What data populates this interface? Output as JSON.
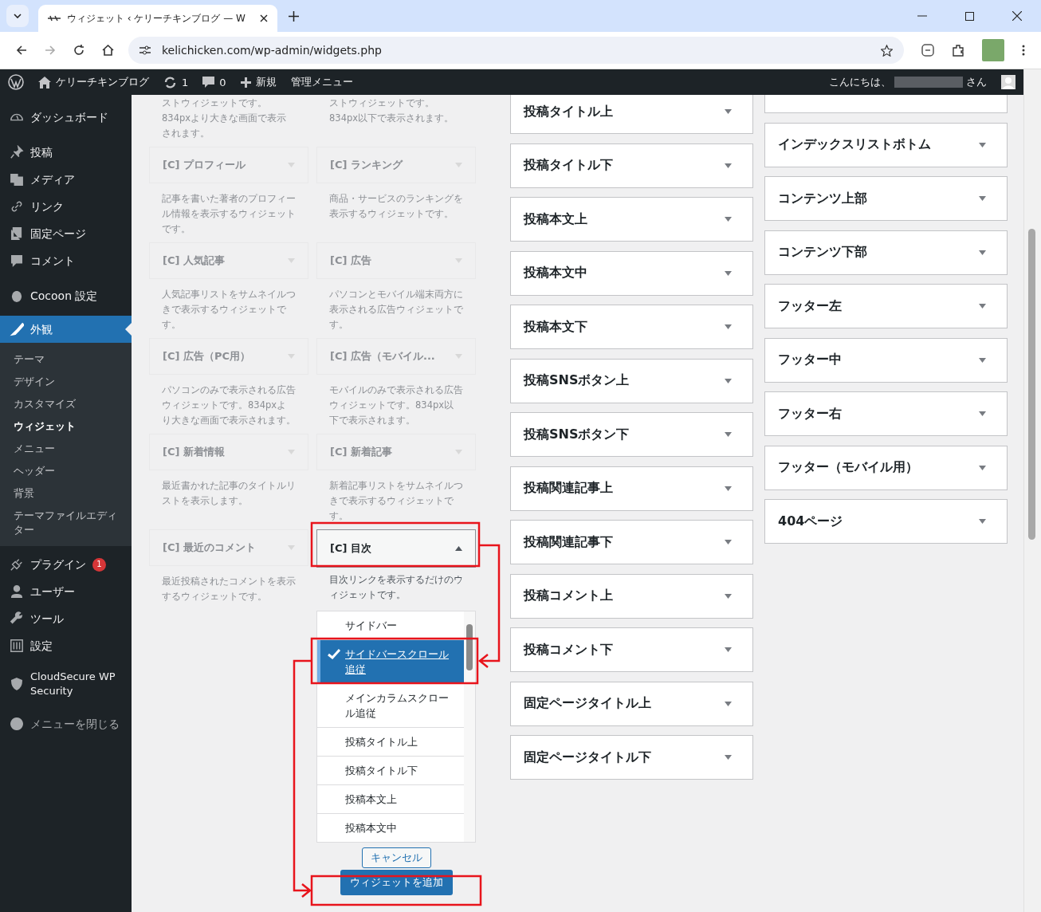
{
  "browser": {
    "tab_title": "ウィジェット ‹ ケリーチキンブログ — W",
    "url": "kelichicken.com/wp-admin/widgets.php"
  },
  "admin_bar": {
    "site_name": "ケリーチキンブログ",
    "updates": "1",
    "comments": "0",
    "new": "新規",
    "admin_menu": "管理メニュー",
    "greeting": "こんにちは、",
    "honorific": "さん"
  },
  "sidebar": {
    "items": [
      {
        "label": "ダッシュボード",
        "selected": false
      },
      {
        "label": "投稿",
        "selected": false
      },
      {
        "label": "メディア",
        "selected": false
      },
      {
        "label": "リンク",
        "selected": false
      },
      {
        "label": "固定ページ",
        "selected": false
      },
      {
        "label": "コメント",
        "selected": false
      },
      {
        "label": "Cocoon 設定",
        "selected": false
      },
      {
        "label": "外観",
        "selected": true,
        "children": [
          {
            "label": "テーマ",
            "selected": false
          },
          {
            "label": "デザイン",
            "selected": false
          },
          {
            "label": "カスタマイズ",
            "selected": false
          },
          {
            "label": "ウィジェット",
            "selected": true
          },
          {
            "label": "メニュー",
            "selected": false
          },
          {
            "label": "ヘッダー",
            "selected": false
          },
          {
            "label": "背景",
            "selected": false
          },
          {
            "label": "テーマファイルエディター",
            "selected": false
          }
        ]
      },
      {
        "label": "プラグイン",
        "selected": false,
        "badge": "1"
      },
      {
        "label": "ユーザー",
        "selected": false
      },
      {
        "label": "ツール",
        "selected": false
      },
      {
        "label": "設定",
        "selected": false
      },
      {
        "label": "CloudSecure WP Security",
        "selected": false
      },
      {
        "label": "メニューを閉じる",
        "selected": false
      }
    ]
  },
  "available_widgets": {
    "top_descriptions": [
      "ストウィジェットです。834pxより大きな画面で表示されます。",
      "ストウィジェットです。834px以下で表示されます。"
    ],
    "widgets": [
      {
        "title": "[C] プロフィール",
        "description": "記事を書いた著者のプロフィール情報を表示するウィジェットです。",
        "expanded": false
      },
      {
        "title": "[C] ランキング",
        "description": "商品・サービスのランキングを表示するウィジェットです。",
        "expanded": false
      },
      {
        "title": "[C] 人気記事",
        "description": "人気記事リストをサムネイルつきで表示するウィジェットです。",
        "expanded": false
      },
      {
        "title": "[C] 広告",
        "description": "パソコンとモバイル端末両方に表示される広告ウィジェットです。",
        "expanded": false
      },
      {
        "title": "[C] 広告（PC用）",
        "description": "パソコンのみで表示される広告ウィジェットです。834pxより大きな画面で表示されます。",
        "expanded": false
      },
      {
        "title": "[C] 広告（モバイル...",
        "description": "モバイルのみで表示される広告ウィジェットです。834px以下で表示されます。",
        "expanded": false
      },
      {
        "title": "[C] 新着情報",
        "description": "最近書かれた記事のタイトルリストを表示します。",
        "expanded": false
      },
      {
        "title": "[C] 新着記事",
        "description": "新着記事リストをサムネイルつきで表示するウィジェットです。",
        "expanded": false
      },
      {
        "title": "[C] 最近のコメント",
        "description": "最近投稿されたコメントを表示するウィジェットです。",
        "expanded": false
      },
      {
        "title": "[C] 目次",
        "description": "目次リンクを表示するだけのウィジェットです。",
        "expanded": true
      }
    ],
    "chooser": {
      "options": [
        {
          "label": "サイドバー",
          "selected": false
        },
        {
          "label": "サイドバースクロール追従",
          "selected": true
        },
        {
          "label": "メインカラムスクロール追従",
          "selected": false
        },
        {
          "label": "投稿タイトル上",
          "selected": false
        },
        {
          "label": "投稿タイトル下",
          "selected": false
        },
        {
          "label": "投稿本文上",
          "selected": false
        },
        {
          "label": "投稿本文中",
          "selected": false
        }
      ],
      "cancel": "キャンセル",
      "add": "ウィジェットを追加"
    }
  },
  "widget_areas_middle": [
    "投稿タイトル上",
    "投稿タイトル下",
    "投稿本文上",
    "投稿本文中",
    "投稿本文下",
    "投稿SNSボタン上",
    "投稿SNSボタン下",
    "投稿関連記事上",
    "投稿関連記事下",
    "投稿コメント上",
    "投稿コメント下",
    "固定ページタイトル上",
    "固定ページタイトル下"
  ],
  "widget_areas_right": [
    "インデックスリストボトム",
    "コンテンツ上部",
    "コンテンツ下部",
    "フッター左",
    "フッター中",
    "フッター右",
    "フッター（モバイル用）",
    "404ページ"
  ]
}
